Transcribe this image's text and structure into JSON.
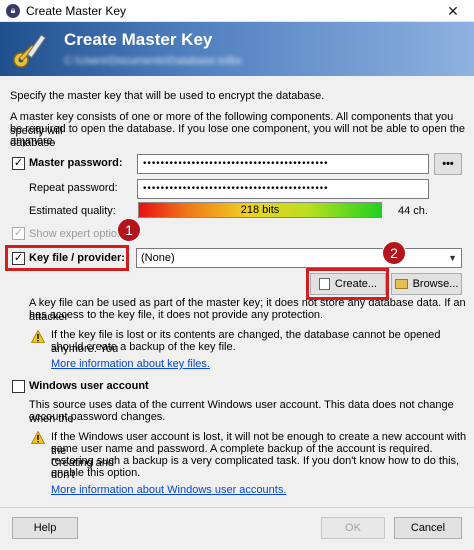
{
  "window": {
    "title": "Create Master Key",
    "close_glyph": "✕"
  },
  "banner": {
    "heading": "Create Master Key",
    "subheading_blurred": "C:\\Users\\Documents\\Database.kdbx"
  },
  "intro": {
    "line1": "Specify the master key that will be used to encrypt the database.",
    "line2a": "A master key consists of one or more of the following components. All components that you specify will",
    "line2b": "be required to open the database. If you lose one component, you will not be able to open the database",
    "line2c": "anymore."
  },
  "master_password": {
    "label": "Master password:",
    "checked": true,
    "value": "••••••••••••••••••••••••••••••••••••••••••",
    "toggle_label": "•••"
  },
  "repeat_password": {
    "label": "Repeat password:",
    "value": "••••••••••••••••••••••••••••••••••••••••••"
  },
  "quality": {
    "label": "Estimated quality:",
    "bits": "218 bits",
    "chars": "44 ch.",
    "level": 1.0
  },
  "expert": {
    "label": "Show expert options",
    "checked": true
  },
  "key_file": {
    "label": "Key file / provider:",
    "checked": true,
    "selected": "(None)",
    "create_label": "Create...",
    "browse_label": "Browse...",
    "desc1": "A key file can be used as part of the master key; it does not store any database data. If an attacker",
    "desc2": "has access to the key file, it does not provide any protection.",
    "warn1": "If the key file is lost or its contents are changed, the database cannot be opened anymore. You",
    "warn2": "should create a backup of the key file.",
    "more_info": "More information about key files."
  },
  "windows_account": {
    "label": "Windows user account",
    "checked": false,
    "desc1": "This source uses data of the current Windows user account. This data does not change when the",
    "desc2": "account password changes.",
    "warn1": "If the Windows user account is lost, it will not be enough to create a new account with the",
    "warn2": "same user name and password. A complete backup of the account is required. Creating and",
    "warn3": "restoring such a backup is a very complicated task. If you don't know how to do this, don't",
    "warn4": "enable this option.",
    "more_info": "More information about Windows user accounts."
  },
  "footer": {
    "help_label": "Help",
    "ok_label": "OK",
    "cancel_label": "Cancel"
  },
  "annotations": {
    "badge1": "1",
    "badge2": "2",
    "highlight_color": "#d11f1f"
  }
}
